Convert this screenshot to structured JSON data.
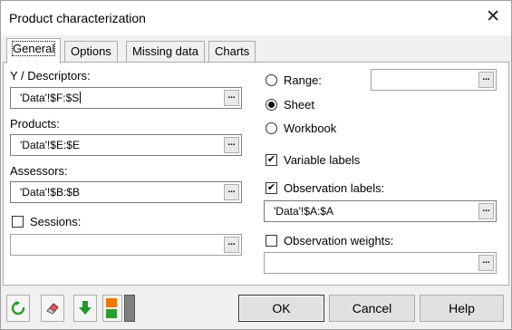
{
  "window": {
    "title": "Product characterization",
    "close_glyph": "✕"
  },
  "tabs": [
    {
      "label": "General",
      "active": true
    },
    {
      "label": "Options",
      "active": false
    },
    {
      "label": "Missing data",
      "active": false
    },
    {
      "label": "Charts",
      "active": false
    }
  ],
  "general": {
    "y_descriptors": {
      "label": "Y / Descriptors:",
      "value": "'Data'!$F:$S"
    },
    "products": {
      "label": "Products:",
      "value": "'Data'!$E:$E"
    },
    "assessors": {
      "label": "Assessors:",
      "value": "'Data'!$B:$B"
    },
    "sessions": {
      "label": "Sessions:",
      "checked": false,
      "value": ""
    },
    "range_options": [
      {
        "label": "Range:",
        "selected": false
      },
      {
        "label": "Sheet",
        "selected": true
      },
      {
        "label": "Workbook",
        "selected": false
      }
    ],
    "range_value": "",
    "variable_labels": {
      "label": "Variable labels",
      "checked": true
    },
    "observation_labels": {
      "label": "Observation labels:",
      "checked": true,
      "value": "'Data'!$A:$A"
    },
    "observation_weights": {
      "label": "Observation weights:",
      "checked": false,
      "value": ""
    },
    "range_button_glyph": "...",
    "check_glyph": "✔"
  },
  "buttons": {
    "ok": "OK",
    "cancel": "Cancel",
    "help": "Help"
  },
  "colors": {
    "green": "#2e9b2e",
    "orange": "#f07800",
    "gray_bar": "#808080"
  }
}
